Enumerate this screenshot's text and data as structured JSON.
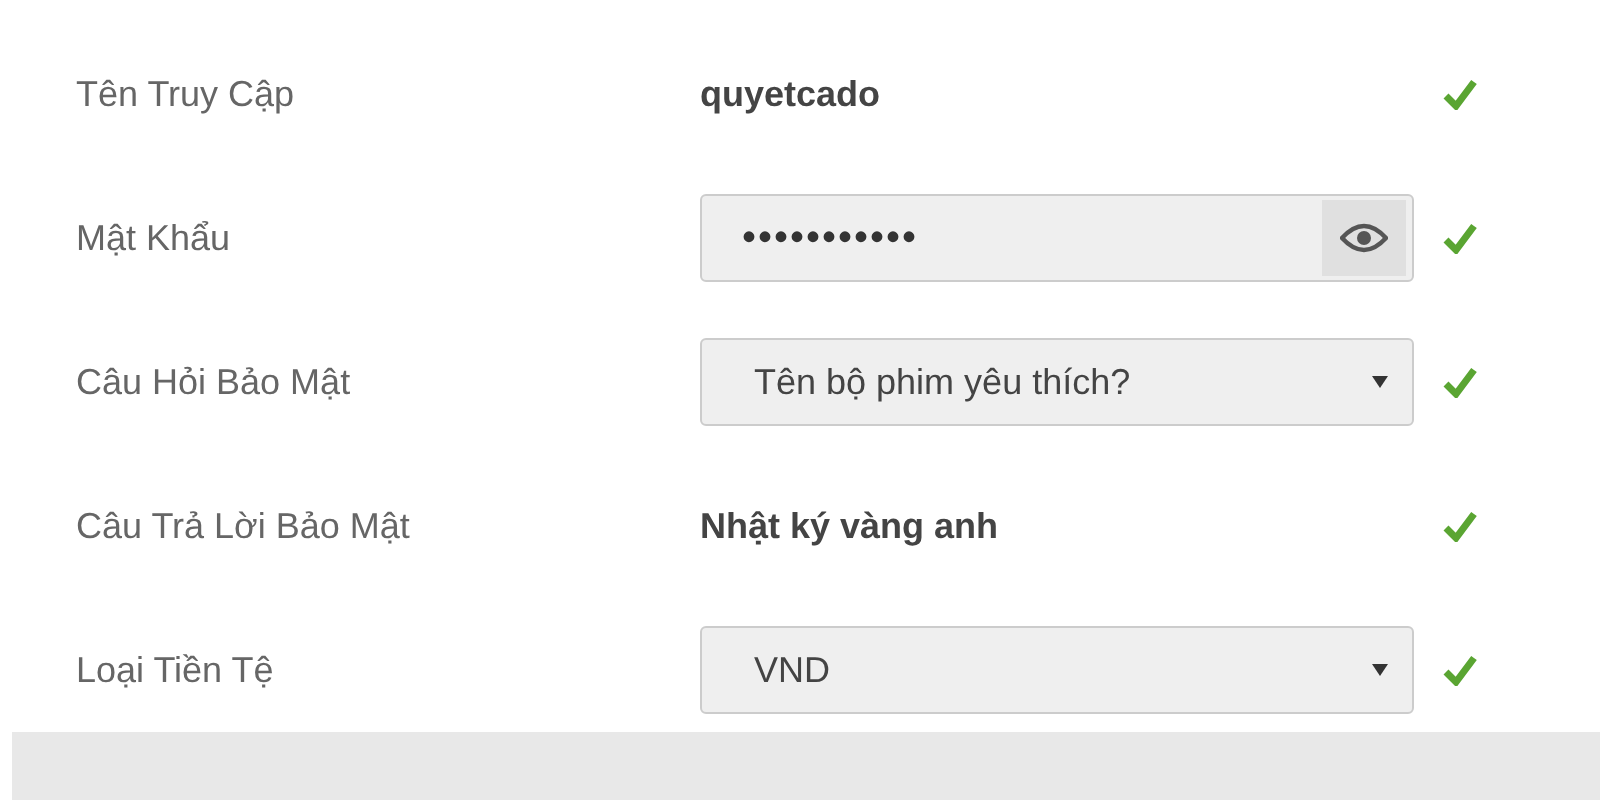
{
  "fields": [
    {
      "label": "Tên Truy Cập",
      "kind": "text",
      "value": "quyetcado",
      "valid": true
    },
    {
      "label": "Mật Khẩu",
      "kind": "password",
      "value": "•••••••••••",
      "valid": true
    },
    {
      "label": "Câu Hỏi Bảo Mật",
      "kind": "select",
      "value": "Tên bộ phim yêu thích?",
      "valid": true
    },
    {
      "label": "Câu Trả Lời Bảo Mật",
      "kind": "text",
      "value": "Nhật ký vàng anh",
      "valid": true
    },
    {
      "label": "Loại Tiền Tệ",
      "kind": "select",
      "value": "VND",
      "valid": true
    }
  ]
}
